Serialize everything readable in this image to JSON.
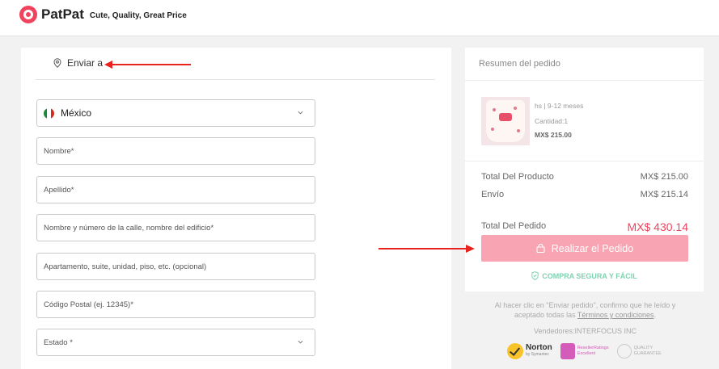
{
  "header": {
    "brand": "PatPat",
    "tagline": "Cute, Quality, Great Price"
  },
  "shipping": {
    "title": "Enviar a",
    "country": "México",
    "fields": {
      "first_name": "Nombre*",
      "last_name": "Apellido*",
      "street": "Nombre y número de la calle, nombre del edificio*",
      "apartment": "Apartamento, suite, unidad, piso, etc. (opcional)",
      "postal_code": "Código Postal (ej. 12345)*",
      "state": "Estado *"
    }
  },
  "summary": {
    "title": "Resumen del pedido",
    "product": {
      "variant": "hs | 9-12 meses",
      "quantity": "Cantidad:1",
      "price": "MX$ 215.00"
    },
    "subtotal_label": "Total Del Producto",
    "subtotal_value": "MX$ 215.00",
    "shipping_label": "Envío",
    "shipping_value": "MX$ 215.14",
    "total_label": "Total Del Pedido",
    "total_value": "MX$ 430.14",
    "place_order": "Realizar el Pedido",
    "secure": "COMPRA SEGURA Y FÁCIL"
  },
  "footer": {
    "terms_prefix": "Al hacer clic en \"Enviar pedido\", confirmo que he leído y aceptado todas las ",
    "terms_link": "Términos y condiciones",
    "terms_suffix": ".",
    "vendor": "Vendedores:INTERFOCUS INC",
    "badges": {
      "norton": "Norton",
      "norton_sub": "by Symantec",
      "reseller_line1": "ResellerRatings",
      "reseller_line2": "Excellent",
      "quality_line1": "QUALITY",
      "quality_line2": "GUARANTEE"
    }
  },
  "colors": {
    "brand": "#f1435d",
    "button": "#f8a4b2",
    "secure": "#7fd2b1",
    "annotation_arrow": "#e8231d"
  },
  "icons": {
    "location": "location-pin-icon",
    "lock": "lock-icon",
    "shield": "shield-check-icon",
    "chevron": "chevron-down-icon"
  }
}
